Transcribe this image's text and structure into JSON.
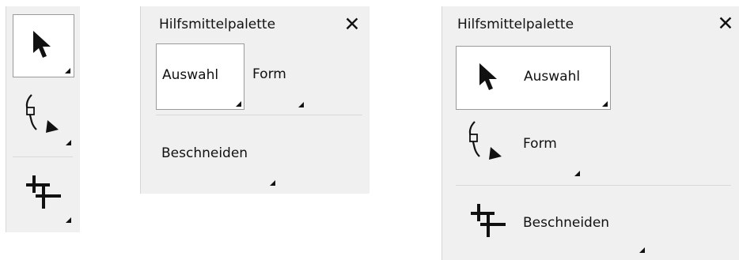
{
  "panel_compact": {
    "tools": [
      {
        "name": "select",
        "icon": "arrow-pointer-icon"
      },
      {
        "name": "shape",
        "icon": "shape-node-icon"
      },
      {
        "name": "crop",
        "icon": "crop-icon"
      }
    ]
  },
  "panel_text": {
    "title": "Hilfsmittelpalette",
    "close_symbol": "✕",
    "tools": {
      "auswahl": "Auswahl",
      "form": "Form",
      "beschneiden": "Beschneiden"
    }
  },
  "panel_icon_text": {
    "title": "Hilfsmittelpalette",
    "close_symbol": "✕",
    "tools": {
      "auswahl": "Auswahl",
      "form": "Form",
      "beschneiden": "Beschneiden"
    }
  }
}
